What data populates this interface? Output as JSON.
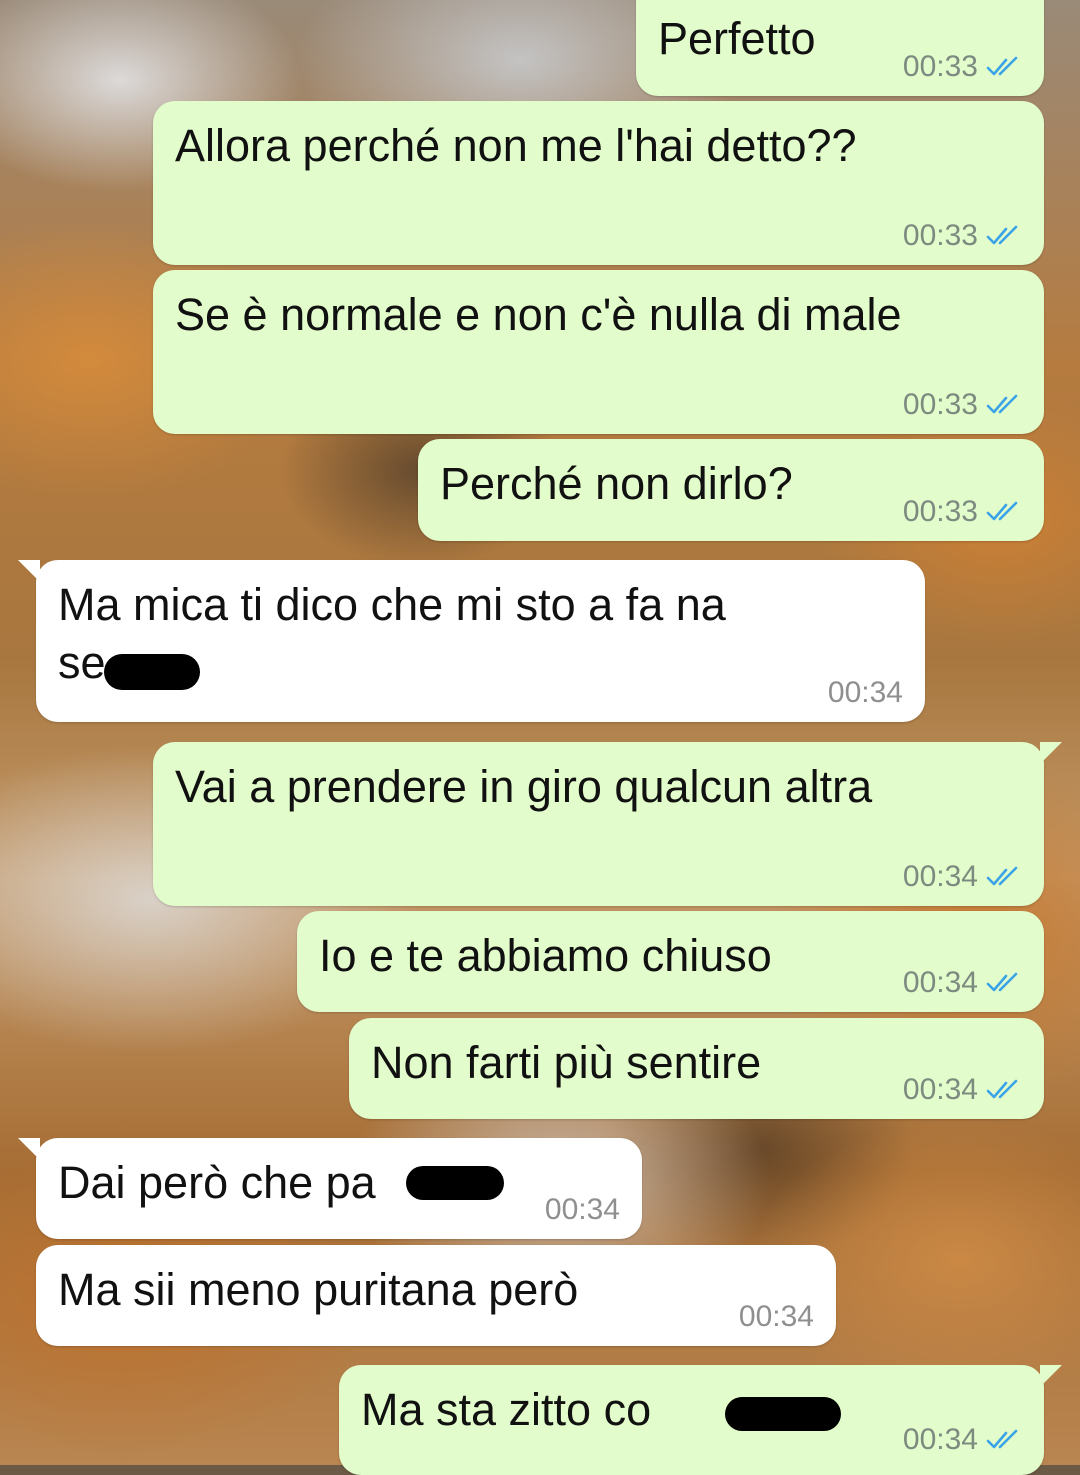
{
  "colors": {
    "outgoing_bubble": "#e2fdcb",
    "incoming_bubble": "#ffffff",
    "read_ticks": "#3aa3e8",
    "time_text": "#7d8a80"
  },
  "messages": [
    {
      "direction": "outgoing",
      "text": "Perfetto",
      "time": "00:33",
      "status_icon": "double-check-read-icon"
    },
    {
      "direction": "outgoing",
      "text": "Allora perché non me l'hai detto??",
      "time": "00:33",
      "status_icon": "double-check-read-icon"
    },
    {
      "direction": "outgoing",
      "text": "Se è normale e non c'è nulla di male",
      "time": "00:33",
      "status_icon": "double-check-read-icon"
    },
    {
      "direction": "outgoing",
      "text": "Perché non dirlo?",
      "time": "00:33",
      "status_icon": "double-check-read-icon"
    },
    {
      "direction": "incoming",
      "text": "Ma mica ti dico che mi sto a fa na\nse",
      "time": "00:34"
    },
    {
      "direction": "outgoing",
      "text": "Vai a prendere in giro qualcun altra",
      "time": "00:34",
      "status_icon": "double-check-read-icon"
    },
    {
      "direction": "outgoing",
      "text": "Io e te abbiamo chiuso",
      "time": "00:34",
      "status_icon": "double-check-read-icon"
    },
    {
      "direction": "outgoing",
      "text": "Non farti più sentire",
      "time": "00:34",
      "status_icon": "double-check-read-icon"
    },
    {
      "direction": "incoming",
      "text": "Dai però che pa",
      "time": "00:34"
    },
    {
      "direction": "incoming",
      "text": "Ma sii meno puritana però",
      "time": "00:34"
    },
    {
      "direction": "outgoing",
      "text": "Ma sta zitto co",
      "time": "00:34",
      "status_icon": "double-check-read-icon"
    }
  ]
}
